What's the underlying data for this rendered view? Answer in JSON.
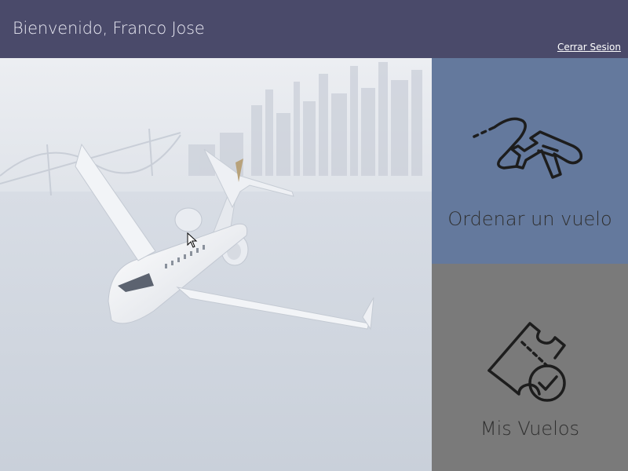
{
  "header": {
    "welcome_text": "Bienvenido, Franco Jose",
    "logout_label": "Cerrar Sesion"
  },
  "hero": {
    "image_icon": "airplane-over-city-icon"
  },
  "tiles": [
    {
      "label": "Ordenar un vuelo",
      "icon": "airplane-route-icon",
      "color": "#64799d"
    },
    {
      "label": "Mis Vuelos",
      "icon": "ticket-check-icon",
      "color": "#7a7a7a"
    }
  ],
  "colors": {
    "header_bg": "#4a4a6a",
    "text_light": "#e8e8f2",
    "tile_text": "#2f2f2f"
  }
}
